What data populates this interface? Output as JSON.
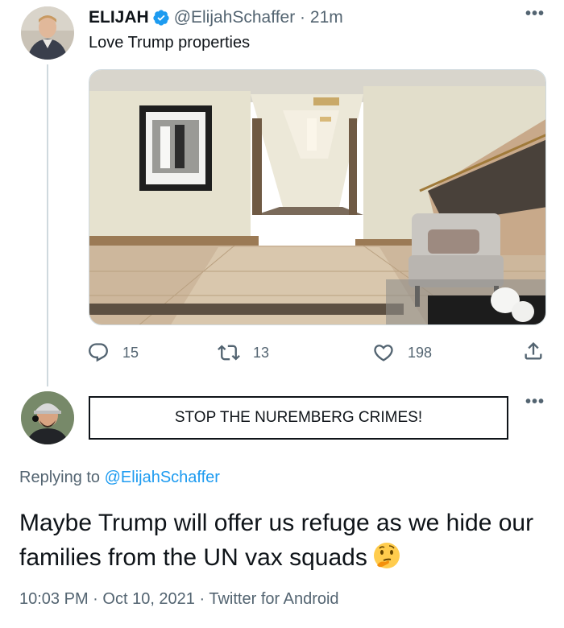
{
  "original_tweet": {
    "name": "ELIJAH",
    "handle": "@ElijahSchaffer",
    "time": "21m",
    "separator": "·",
    "text": "Love Trump properties",
    "image_alt": "Hotel hallway with framed photo, marble floor and staircase",
    "actions": {
      "reply_count": "15",
      "retweet_count": "13",
      "like_count": "198"
    }
  },
  "banner": {
    "text": "STOP THE NUREMBERG CRIMES!"
  },
  "reply": {
    "replying_prefix": "Replying to",
    "replying_handle": "@ElijahSchaffer",
    "text": "Maybe Trump will offer us refuge as we hide our families from the UN vax squads",
    "emoji_icon": "thinking-face-icon",
    "time": "10:03 PM",
    "date": "Oct 10, 2021",
    "client": "Twitter for Android",
    "separator": "·"
  },
  "colors": {
    "accent": "#1d9bf0",
    "text_primary": "#0f1419",
    "text_secondary": "#536471",
    "border": "#cfd9de"
  }
}
